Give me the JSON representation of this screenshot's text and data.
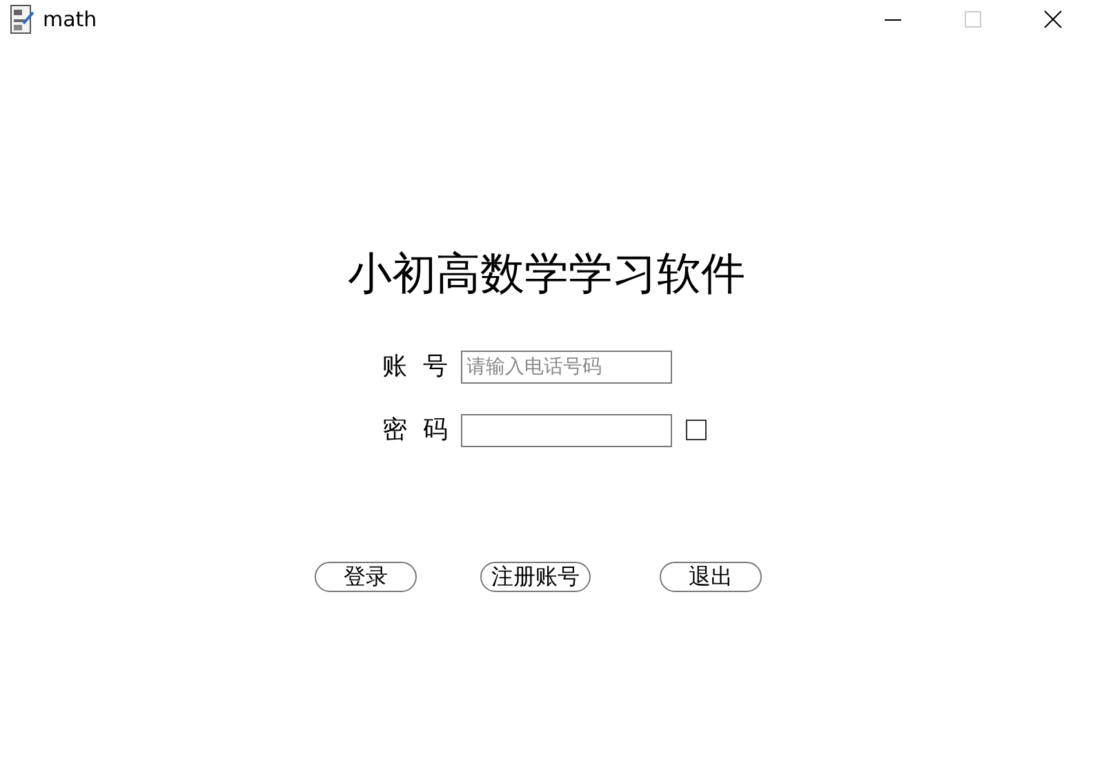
{
  "window": {
    "title": "math"
  },
  "heading": "小初高数学学习软件",
  "fields": [
    {
      "label": "账  号",
      "placeholder": "请输入电话号码"
    },
    {
      "label": "密  码",
      "checkbox": {
        "checked": false
      }
    }
  ],
  "buttons": [
    "登录",
    "注册账号",
    "退出"
  ]
}
